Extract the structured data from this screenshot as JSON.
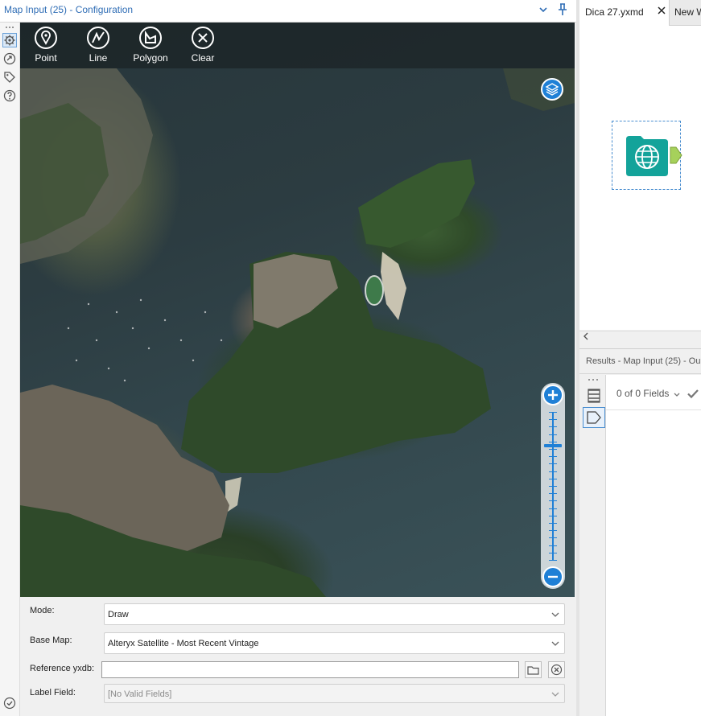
{
  "config_panel": {
    "title": "Map Input (25) - Configuration",
    "collapse_icon": "chevron-down-icon",
    "pin_icon": "pin-icon"
  },
  "left_strip": {
    "items": [
      {
        "name": "settings",
        "icon": "gear-icon"
      },
      {
        "name": "annotation",
        "icon": "annotation-icon"
      },
      {
        "name": "tag",
        "icon": "tag-icon"
      },
      {
        "name": "help",
        "icon": "help-icon"
      }
    ],
    "status_icon": "check-circle-icon"
  },
  "map": {
    "tools": [
      {
        "label": "Point",
        "icon": "map-pin-icon"
      },
      {
        "label": "Line",
        "icon": "line-icon"
      },
      {
        "label": "Polygon",
        "icon": "polygon-icon"
      },
      {
        "label": "Clear",
        "icon": "close-circle-icon"
      }
    ],
    "layers_icon": "layers-icon",
    "zoom": {
      "in_icon": "plus-icon",
      "out_icon": "minus-icon",
      "level_fraction": 0.23
    }
  },
  "form": {
    "mode_label": "Mode:",
    "mode_value": "Draw",
    "basemap_label": "Base Map:",
    "basemap_value": "Alteryx Satellite - Most Recent Vintage",
    "reference_label": "Reference yxdb:",
    "reference_value": "",
    "label_field_label": "Label Field:",
    "label_field_value": "[No Valid Fields]"
  },
  "workflow": {
    "tabs": [
      {
        "label": "Dica 27.yxmd",
        "active": true
      },
      {
        "label": "New W"
      }
    ],
    "tool_icon": "globe-icon"
  },
  "results": {
    "title": "Results - Map Input (25) - Ou",
    "fields_count": "0 of 0 Fields"
  },
  "colors": {
    "accent_blue": "#1f80d6",
    "title_blue": "#2f6db5",
    "tool_teal": "#13a39a",
    "anchor_green": "#a6d15b"
  }
}
